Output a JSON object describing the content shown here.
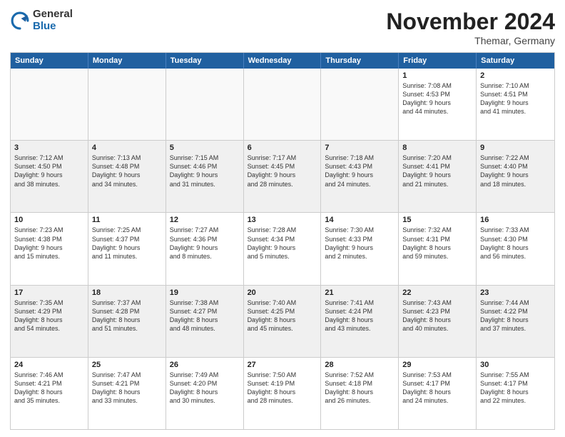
{
  "logo": {
    "general": "General",
    "blue": "Blue"
  },
  "header": {
    "month": "November 2024",
    "location": "Themar, Germany"
  },
  "days": [
    "Sunday",
    "Monday",
    "Tuesday",
    "Wednesday",
    "Thursday",
    "Friday",
    "Saturday"
  ],
  "rows": [
    [
      {
        "day": "",
        "empty": true
      },
      {
        "day": "",
        "empty": true
      },
      {
        "day": "",
        "empty": true
      },
      {
        "day": "",
        "empty": true
      },
      {
        "day": "",
        "empty": true
      },
      {
        "day": "1",
        "info": "Sunrise: 7:08 AM\nSunset: 4:53 PM\nDaylight: 9 hours\nand 44 minutes."
      },
      {
        "day": "2",
        "info": "Sunrise: 7:10 AM\nSunset: 4:51 PM\nDaylight: 9 hours\nand 41 minutes."
      }
    ],
    [
      {
        "day": "3",
        "info": "Sunrise: 7:12 AM\nSunset: 4:50 PM\nDaylight: 9 hours\nand 38 minutes.",
        "shaded": true
      },
      {
        "day": "4",
        "info": "Sunrise: 7:13 AM\nSunset: 4:48 PM\nDaylight: 9 hours\nand 34 minutes.",
        "shaded": true
      },
      {
        "day": "5",
        "info": "Sunrise: 7:15 AM\nSunset: 4:46 PM\nDaylight: 9 hours\nand 31 minutes.",
        "shaded": true
      },
      {
        "day": "6",
        "info": "Sunrise: 7:17 AM\nSunset: 4:45 PM\nDaylight: 9 hours\nand 28 minutes.",
        "shaded": true
      },
      {
        "day": "7",
        "info": "Sunrise: 7:18 AM\nSunset: 4:43 PM\nDaylight: 9 hours\nand 24 minutes.",
        "shaded": true
      },
      {
        "day": "8",
        "info": "Sunrise: 7:20 AM\nSunset: 4:41 PM\nDaylight: 9 hours\nand 21 minutes.",
        "shaded": true
      },
      {
        "day": "9",
        "info": "Sunrise: 7:22 AM\nSunset: 4:40 PM\nDaylight: 9 hours\nand 18 minutes.",
        "shaded": true
      }
    ],
    [
      {
        "day": "10",
        "info": "Sunrise: 7:23 AM\nSunset: 4:38 PM\nDaylight: 9 hours\nand 15 minutes."
      },
      {
        "day": "11",
        "info": "Sunrise: 7:25 AM\nSunset: 4:37 PM\nDaylight: 9 hours\nand 11 minutes."
      },
      {
        "day": "12",
        "info": "Sunrise: 7:27 AM\nSunset: 4:36 PM\nDaylight: 9 hours\nand 8 minutes."
      },
      {
        "day": "13",
        "info": "Sunrise: 7:28 AM\nSunset: 4:34 PM\nDaylight: 9 hours\nand 5 minutes."
      },
      {
        "day": "14",
        "info": "Sunrise: 7:30 AM\nSunset: 4:33 PM\nDaylight: 9 hours\nand 2 minutes."
      },
      {
        "day": "15",
        "info": "Sunrise: 7:32 AM\nSunset: 4:31 PM\nDaylight: 8 hours\nand 59 minutes."
      },
      {
        "day": "16",
        "info": "Sunrise: 7:33 AM\nSunset: 4:30 PM\nDaylight: 8 hours\nand 56 minutes."
      }
    ],
    [
      {
        "day": "17",
        "info": "Sunrise: 7:35 AM\nSunset: 4:29 PM\nDaylight: 8 hours\nand 54 minutes.",
        "shaded": true
      },
      {
        "day": "18",
        "info": "Sunrise: 7:37 AM\nSunset: 4:28 PM\nDaylight: 8 hours\nand 51 minutes.",
        "shaded": true
      },
      {
        "day": "19",
        "info": "Sunrise: 7:38 AM\nSunset: 4:27 PM\nDaylight: 8 hours\nand 48 minutes.",
        "shaded": true
      },
      {
        "day": "20",
        "info": "Sunrise: 7:40 AM\nSunset: 4:25 PM\nDaylight: 8 hours\nand 45 minutes.",
        "shaded": true
      },
      {
        "day": "21",
        "info": "Sunrise: 7:41 AM\nSunset: 4:24 PM\nDaylight: 8 hours\nand 43 minutes.",
        "shaded": true
      },
      {
        "day": "22",
        "info": "Sunrise: 7:43 AM\nSunset: 4:23 PM\nDaylight: 8 hours\nand 40 minutes.",
        "shaded": true
      },
      {
        "day": "23",
        "info": "Sunrise: 7:44 AM\nSunset: 4:22 PM\nDaylight: 8 hours\nand 37 minutes.",
        "shaded": true
      }
    ],
    [
      {
        "day": "24",
        "info": "Sunrise: 7:46 AM\nSunset: 4:21 PM\nDaylight: 8 hours\nand 35 minutes."
      },
      {
        "day": "25",
        "info": "Sunrise: 7:47 AM\nSunset: 4:21 PM\nDaylight: 8 hours\nand 33 minutes."
      },
      {
        "day": "26",
        "info": "Sunrise: 7:49 AM\nSunset: 4:20 PM\nDaylight: 8 hours\nand 30 minutes."
      },
      {
        "day": "27",
        "info": "Sunrise: 7:50 AM\nSunset: 4:19 PM\nDaylight: 8 hours\nand 28 minutes."
      },
      {
        "day": "28",
        "info": "Sunrise: 7:52 AM\nSunset: 4:18 PM\nDaylight: 8 hours\nand 26 minutes."
      },
      {
        "day": "29",
        "info": "Sunrise: 7:53 AM\nSunset: 4:17 PM\nDaylight: 8 hours\nand 24 minutes."
      },
      {
        "day": "30",
        "info": "Sunrise: 7:55 AM\nSunset: 4:17 PM\nDaylight: 8 hours\nand 22 minutes."
      }
    ]
  ]
}
